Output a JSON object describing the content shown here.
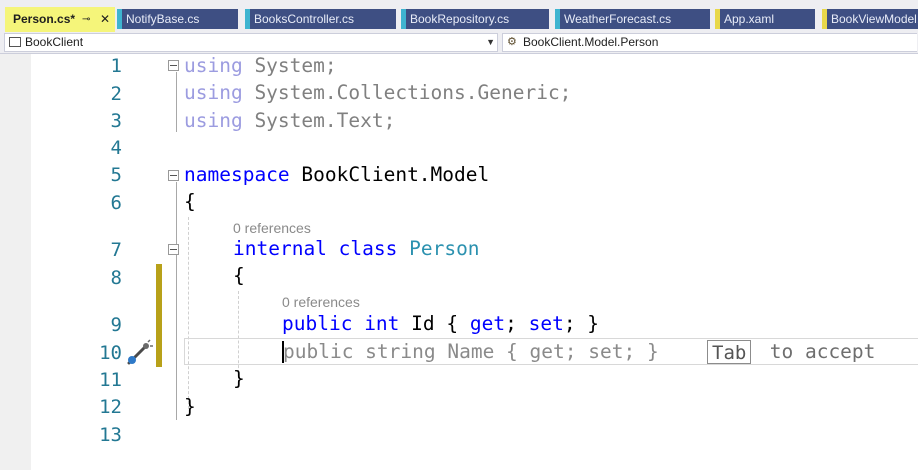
{
  "tabs": [
    {
      "label": "Person.cs*",
      "active": true
    },
    {
      "label": "NotifyBase.cs",
      "stripe": "#3eb4d0"
    },
    {
      "label": "BooksController.cs",
      "stripe": "#3eb4d0"
    },
    {
      "label": "BookRepository.cs",
      "stripe": "#3eb4d0"
    },
    {
      "label": "WeatherForecast.cs",
      "stripe": "#3eb4d0"
    },
    {
      "label": "App.xaml",
      "stripe": "#e8d84a"
    },
    {
      "label": "BookViewModel.",
      "stripe": "#e8d84a"
    }
  ],
  "tab_pin_icon": "pin-icon",
  "tab_close_icon": "close-icon",
  "nav": {
    "project": "BookClient",
    "member": "BookClient.Model.Person"
  },
  "lines": [
    "1",
    "2",
    "3",
    "4",
    "5",
    "6",
    "7",
    "8",
    "9",
    "10",
    "11",
    "12",
    "13"
  ],
  "code": {
    "l1_kw": "using",
    "l1_rest": " System;",
    "l2_kw": "using",
    "l2_rest": " System.Collections.Generic;",
    "l3_kw": "using",
    "l3_rest": " System.Text;",
    "l5_kw": "namespace",
    "l5_rest": " BookClient.Model",
    "l6": "{",
    "ref1": "0 references",
    "l7_kw1": "internal",
    "l7_kw2": " class ",
    "l7_type": "Person",
    "l8": "{",
    "ref2": "0 references",
    "l9_kw1": "public",
    "l9_kw2": " int",
    "l9_mid": " Id { ",
    "l9_get": "get",
    "l9_semi1": "; ",
    "l9_set": "set",
    "l9_end": "; }",
    "l10_ghost": "public string Name { get; set; }",
    "l11": "}",
    "l12": "}"
  },
  "suggestion": {
    "key": "Tab",
    "text": " to accept"
  },
  "icons": {
    "copilot": "copilot-suggestion-icon"
  },
  "colors": {
    "keyword": "#0000ff",
    "type": "#2b91af",
    "line_number": "#237893",
    "change_marker": "#b8a119",
    "active_tab": "#f5f57a"
  }
}
